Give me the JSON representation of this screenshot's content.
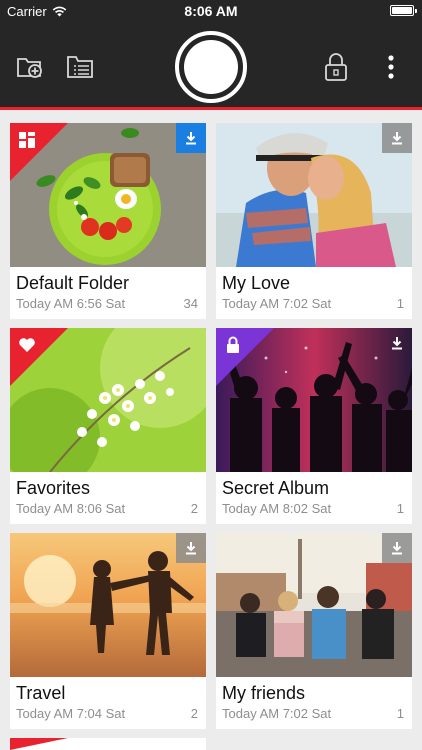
{
  "status_bar": {
    "carrier": "Carrier",
    "time": "8:06 AM"
  },
  "toolbar": {
    "new_folder_icon": "folder-add-icon",
    "list_icon": "list-icon",
    "shutter": "camera-shutter",
    "lock_icon": "lock-icon",
    "more_icon": "more-vertical-icon"
  },
  "colors": {
    "accent": "#e8232f",
    "toolbar": "#262626",
    "secret": "#7b34d6",
    "download_active": "#1a7fe0"
  },
  "albums": [
    {
      "title": "Default Folder",
      "subtitle": "Today AM 6:56 Sat",
      "count": "34",
      "badge": "grid-icon",
      "download": "blue"
    },
    {
      "title": "My Love",
      "subtitle": "Today AM 7:02 Sat",
      "count": "1",
      "badge": "",
      "download": "gray"
    },
    {
      "title": "Favorites",
      "subtitle": "Today AM 8:06 Sat",
      "count": "2",
      "badge": "heart-icon",
      "download": ""
    },
    {
      "title": "Secret Album",
      "subtitle": "Today AM 8:02 Sat",
      "count": "1",
      "badge": "lock-icon",
      "download": "clear"
    },
    {
      "title": "Travel",
      "subtitle": "Today AM 7:04 Sat",
      "count": "2",
      "badge": "",
      "download": "gray"
    },
    {
      "title": "My friends",
      "subtitle": "Today AM 7:02 Sat",
      "count": "1",
      "badge": "",
      "download": "gray"
    }
  ]
}
